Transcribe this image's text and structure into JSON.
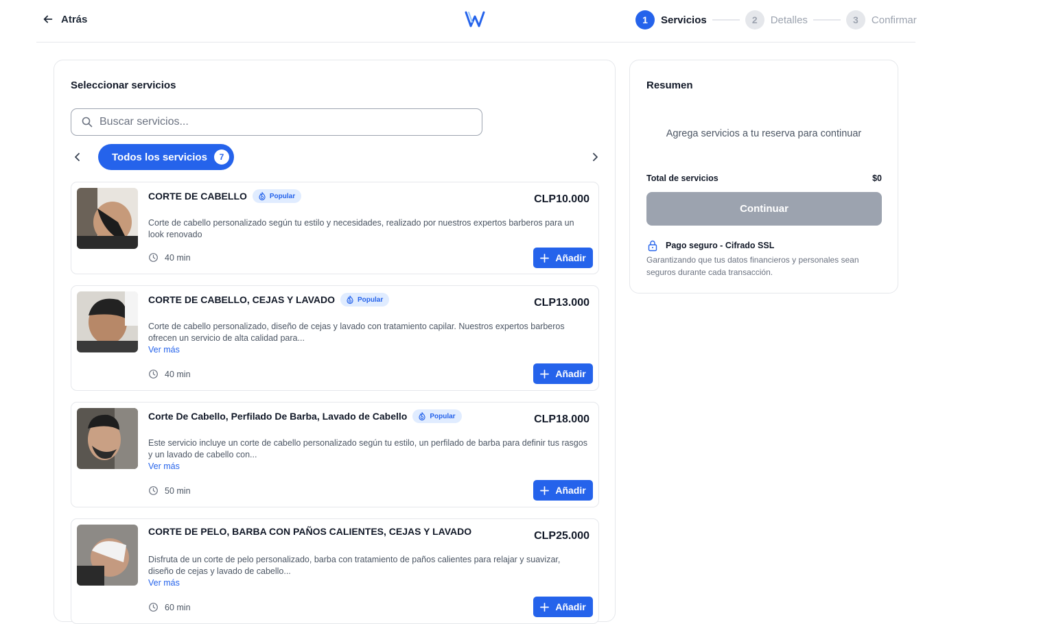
{
  "header": {
    "back_label": "Atrás",
    "steps": [
      {
        "num": "1",
        "label": "Servicios"
      },
      {
        "num": "2",
        "label": "Detalles"
      },
      {
        "num": "3",
        "label": "Confirmar"
      }
    ]
  },
  "services_panel": {
    "title": "Seleccionar servicios",
    "search_placeholder": "Buscar servicios...",
    "category": {
      "label": "Todos los servicios",
      "count": "7"
    },
    "add_label": "Añadir",
    "more_label": "Ver más",
    "badge_label": "Popular",
    "items": [
      {
        "title": "CORTE DE CABELLO",
        "popular": true,
        "price": "CLP10.000",
        "description": "Corte de cabello personalizado según tu estilo y necesidades, realizado por nuestros expertos barberos para un look renovado",
        "duration": "40 min"
      },
      {
        "title": "CORTE DE CABELLO, CEJAS Y LAVADO",
        "popular": true,
        "price": "CLP13.000",
        "description": "Corte de cabello personalizado, diseño de cejas y lavado con tratamiento capilar. Nuestros expertos barberos ofrecen un servicio de alta calidad para...",
        "duration": "40 min"
      },
      {
        "title": "Corte De Cabello, Perfilado De Barba, Lavado de Cabello",
        "popular": true,
        "price": "CLP18.000",
        "description": "Este servicio incluye un corte de cabello personalizado según tu estilo, un perfilado de barba para definir tus rasgos y un lavado de cabello con...",
        "duration": "50 min"
      },
      {
        "title": "CORTE DE PELO, BARBA CON PAÑOS CALIENTES, CEJAS Y LAVADO",
        "popular": false,
        "price": "CLP25.000",
        "description": "Disfruta de un corte de pelo personalizado, barba con tratamiento de paños calientes para relajar y suavizar, diseño de cejas y lavado de cabello...",
        "duration": "60 min"
      }
    ]
  },
  "summary": {
    "title": "Resumen",
    "empty_message": "Agrega servicios a tu reserva para continuar",
    "total_label": "Total de servicios",
    "total_value": "$0",
    "continue_label": "Continuar",
    "secure_title": "Pago seguro - Cifrado SSL",
    "secure_text": "Garantizando que tus datos financieros y personales sean seguros durante cada transacción."
  },
  "colors": {
    "accent": "#2563eb",
    "disabled": "#9ca3af",
    "badge_bg": "#e0ecff"
  },
  "icons": [
    "arrow-left-icon",
    "logo-icon",
    "search-icon",
    "chevron-left-icon",
    "chevron-right-icon",
    "flame-icon",
    "clock-icon",
    "plus-icon",
    "lock-icon"
  ]
}
